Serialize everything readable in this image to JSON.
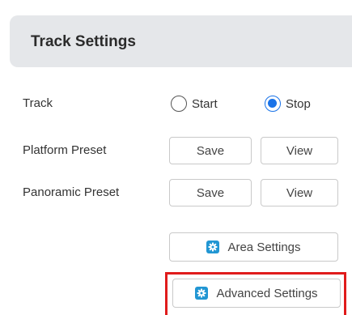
{
  "panel": {
    "title": "Track Settings"
  },
  "track": {
    "label": "Track",
    "options": [
      {
        "label": "Start",
        "selected": false
      },
      {
        "label": "Stop",
        "selected": true
      }
    ]
  },
  "platform_preset": {
    "label": "Platform Preset",
    "save_label": "Save",
    "view_label": "View"
  },
  "panoramic_preset": {
    "label": "Panoramic Preset",
    "save_label": "Save",
    "view_label": "View"
  },
  "area_settings": {
    "label": "Area Settings",
    "icon": "gear-icon"
  },
  "advanced_settings": {
    "label": "Advanced Settings",
    "icon": "gear-icon",
    "highlighted": true
  },
  "colors": {
    "accent": "#1a73e8",
    "icon": "#2196d3",
    "highlight": "#e01b1b",
    "header_bg": "#e5e7ea"
  }
}
